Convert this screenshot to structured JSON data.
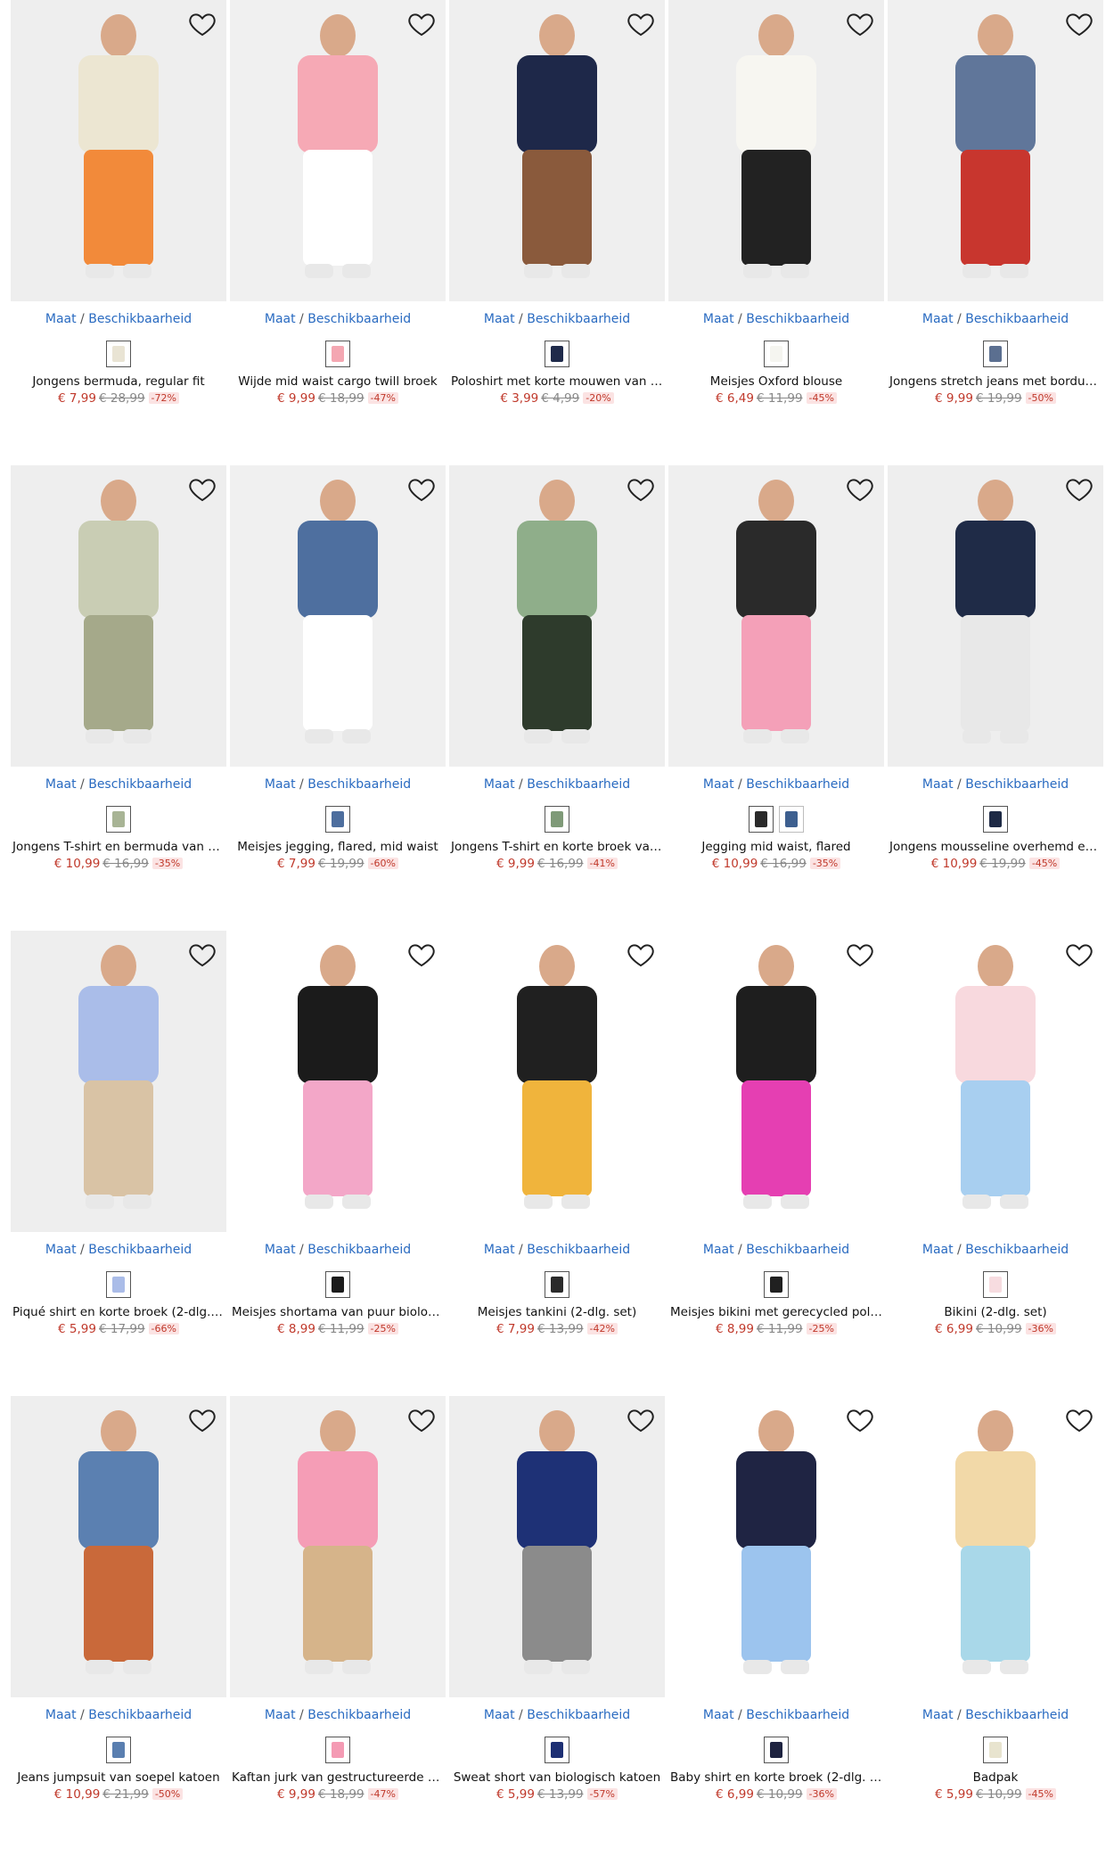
{
  "size_link": {
    "maat": "Maat",
    "sep": " / ",
    "beschikbaarheid": "Beschikbaarheid"
  },
  "colors": {
    "link": "#2a6bc1",
    "price": "#c0392b",
    "discount_bg": "#fbe3e3"
  },
  "products": [
    {
      "title": "Jongens bermuda, regular fit",
      "price": "€ 7,99",
      "old_price": "€ 28,99",
      "discount": "-72%",
      "swatches": [
        "#e9e4d4"
      ],
      "bg": "#eeeeee",
      "main": "#ece6d2",
      "accent": "#f28a3a"
    },
    {
      "title": "Wijde mid waist cargo twill broek",
      "price": "€ 9,99",
      "old_price": "€ 18,99",
      "discount": "-47%",
      "swatches": [
        "#f4a7b2"
      ],
      "bg": "#f0f0f0",
      "main": "#f6a9b5",
      "accent": "#ffffff"
    },
    {
      "title": "Poloshirt met korte mouwen van p...",
      "price": "€ 3,99",
      "old_price": "€ 4,99",
      "discount": "-20%",
      "swatches": [
        "#1f2a4a"
      ],
      "bg": "#efefef",
      "main": "#1e2849",
      "accent": "#8a5a3c"
    },
    {
      "title": "Meisjes Oxford blouse",
      "price": "€ 6,49",
      "old_price": "€ 11,99",
      "discount": "-45%",
      "swatches": [
        "#f5f5f0"
      ],
      "bg": "#eeeeee",
      "main": "#f7f6f1",
      "accent": "#222222"
    },
    {
      "title": "Jongens stretch jeans met borduur...",
      "price": "€ 9,99",
      "old_price": "€ 19,99",
      "discount": "-50%",
      "swatches": [
        "#5b6f90"
      ],
      "bg": "#f0f0f0",
      "main": "#60769a",
      "accent": "#c8362e"
    },
    {
      "title": "Jongens T-shirt en bermuda van bio...",
      "price": "€ 10,99",
      "old_price": "€ 16,99",
      "discount": "-35%",
      "swatches": [
        "#a8b495"
      ],
      "bg": "#eeeeee",
      "main": "#c9cdb4",
      "accent": "#a5a98a"
    },
    {
      "title": "Meisjes jegging, flared, mid waist",
      "price": "€ 7,99",
      "old_price": "€ 19,99",
      "discount": "-60%",
      "swatches": [
        "#4d6e9e"
      ],
      "bg": "#f0f0f0",
      "main": "#4e6f9f",
      "accent": "#ffffff"
    },
    {
      "title": "Jongens T-shirt en korte broek van ...",
      "price": "€ 9,99",
      "old_price": "€ 16,99",
      "discount": "-41%",
      "swatches": [
        "#7f9a78"
      ],
      "bg": "#eeeeee",
      "main": "#8fae8a",
      "accent": "#2e3b2c"
    },
    {
      "title": "Jegging mid waist, flared",
      "price": "€ 10,99",
      "old_price": "€ 16,99",
      "discount": "-35%",
      "swatches": [
        "#2a2a2a",
        "#3d5f8f"
      ],
      "bg": "#efefef",
      "main": "#2a2a2a",
      "accent": "#f4a0b8"
    },
    {
      "title": "Jongens mousseline overhemd en b...",
      "price": "€ 10,99",
      "old_price": "€ 19,99",
      "discount": "-45%",
      "swatches": [
        "#1e2a45"
      ],
      "bg": "#eeeeee",
      "main": "#1f2b47",
      "accent": "#e8e8e8"
    },
    {
      "title": "Piqué shirt en korte broek (2-dlg. s...",
      "price": "€ 5,99",
      "old_price": "€ 17,99",
      "discount": "-66%",
      "swatches": [
        "#aabce8"
      ],
      "bg": "#eeeeee",
      "main": "#aabde9",
      "accent": "#d9c3a5"
    },
    {
      "title": "Meisjes shortama van puur biologis...",
      "price": "€ 8,99",
      "old_price": "€ 11,99",
      "discount": "-25%",
      "swatches": [
        "#1c1c1c"
      ],
      "bg": "#ffffff",
      "main": "#1b1b1b",
      "accent": "#f3a7c8"
    },
    {
      "title": "Meisjes tankini (2-dlg. set)",
      "price": "€ 7,99",
      "old_price": "€ 13,99",
      "discount": "-42%",
      "swatches": [
        "#2b2b2b"
      ],
      "bg": "#ffffff",
      "main": "#202020",
      "accent": "#f0b43c"
    },
    {
      "title": "Meisjes bikini met gerecycled polya...",
      "price": "€ 8,99",
      "old_price": "€ 11,99",
      "discount": "-25%",
      "swatches": [
        "#202020"
      ],
      "bg": "#ffffff",
      "main": "#1e1e1e",
      "accent": "#e53fb2"
    },
    {
      "title": "Bikini (2-dlg. set)",
      "price": "€ 6,99",
      "old_price": "€ 10,99",
      "discount": "-36%",
      "swatches": [
        "#f7dce0"
      ],
      "bg": "#ffffff",
      "main": "#f8d9de",
      "accent": "#a8cff0"
    },
    {
      "title": "Jeans jumpsuit van soepel katoen",
      "price": "€ 10,99",
      "old_price": "€ 21,99",
      "discount": "-50%",
      "swatches": [
        "#5a7fb0"
      ],
      "bg": "#eeeeee",
      "main": "#5b80b1",
      "accent": "#c9693a"
    },
    {
      "title": "Kaftan jurk van gestructureerde cri...",
      "price": "€ 9,99",
      "old_price": "€ 18,99",
      "discount": "-47%",
      "swatches": [
        "#f49bb4"
      ],
      "bg": "#f0f0f0",
      "main": "#f59db6",
      "accent": "#d6b48a"
    },
    {
      "title": "Sweat short van biologisch katoen",
      "price": "€ 5,99",
      "old_price": "€ 13,99",
      "discount": "-57%",
      "swatches": [
        "#1d2f73"
      ],
      "bg": "#eeeeee",
      "main": "#1e3176",
      "accent": "#8b8b8b"
    },
    {
      "title": "Baby shirt en korte broek (2-dlg. set)",
      "price": "€ 6,99",
      "old_price": "€ 10,99",
      "discount": "-36%",
      "swatches": [
        "#1e2340"
      ],
      "bg": "#ffffff",
      "main": "#1f2443",
      "accent": "#9cc4ee"
    },
    {
      "title": "Badpak",
      "price": "€ 5,99",
      "old_price": "€ 10,99",
      "discount": "-45%",
      "swatches": [
        "#e8e4cf"
      ],
      "bg": "#ffffff",
      "main": "#f2d9a8",
      "accent": "#a9d8e9"
    }
  ]
}
